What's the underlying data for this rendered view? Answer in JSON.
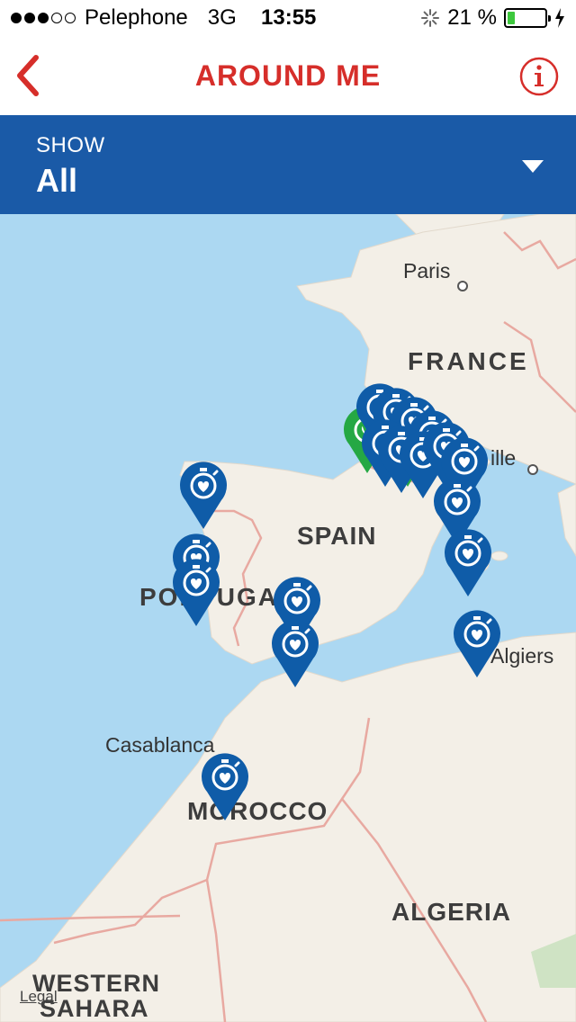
{
  "status_bar": {
    "carrier": "Pelephone",
    "network": "3G",
    "time": "13:55",
    "battery_percent": "21 %",
    "battery_level": 0.21,
    "signal_bars_filled": 3,
    "signal_bars_total": 5
  },
  "nav": {
    "title": "AROUND ME",
    "back_icon": "chevron-left-icon",
    "info_icon": "info-icon",
    "accent_color": "#d62e2a"
  },
  "filter": {
    "label": "SHOW",
    "value": "All",
    "background_color": "#1a5aa7"
  },
  "map": {
    "country_labels": [
      "FRANCE",
      "SPAIN",
      "PORTUGAL",
      "MOROCCO",
      "ALGERIA",
      "WESTERN",
      "SAHARA"
    ],
    "city_labels": [
      "Paris",
      "ille",
      "Algiers",
      "Casablanca"
    ],
    "legal": "Legal",
    "marker_color_blue": "#0f5ca8",
    "marker_color_green": "#25a844"
  }
}
